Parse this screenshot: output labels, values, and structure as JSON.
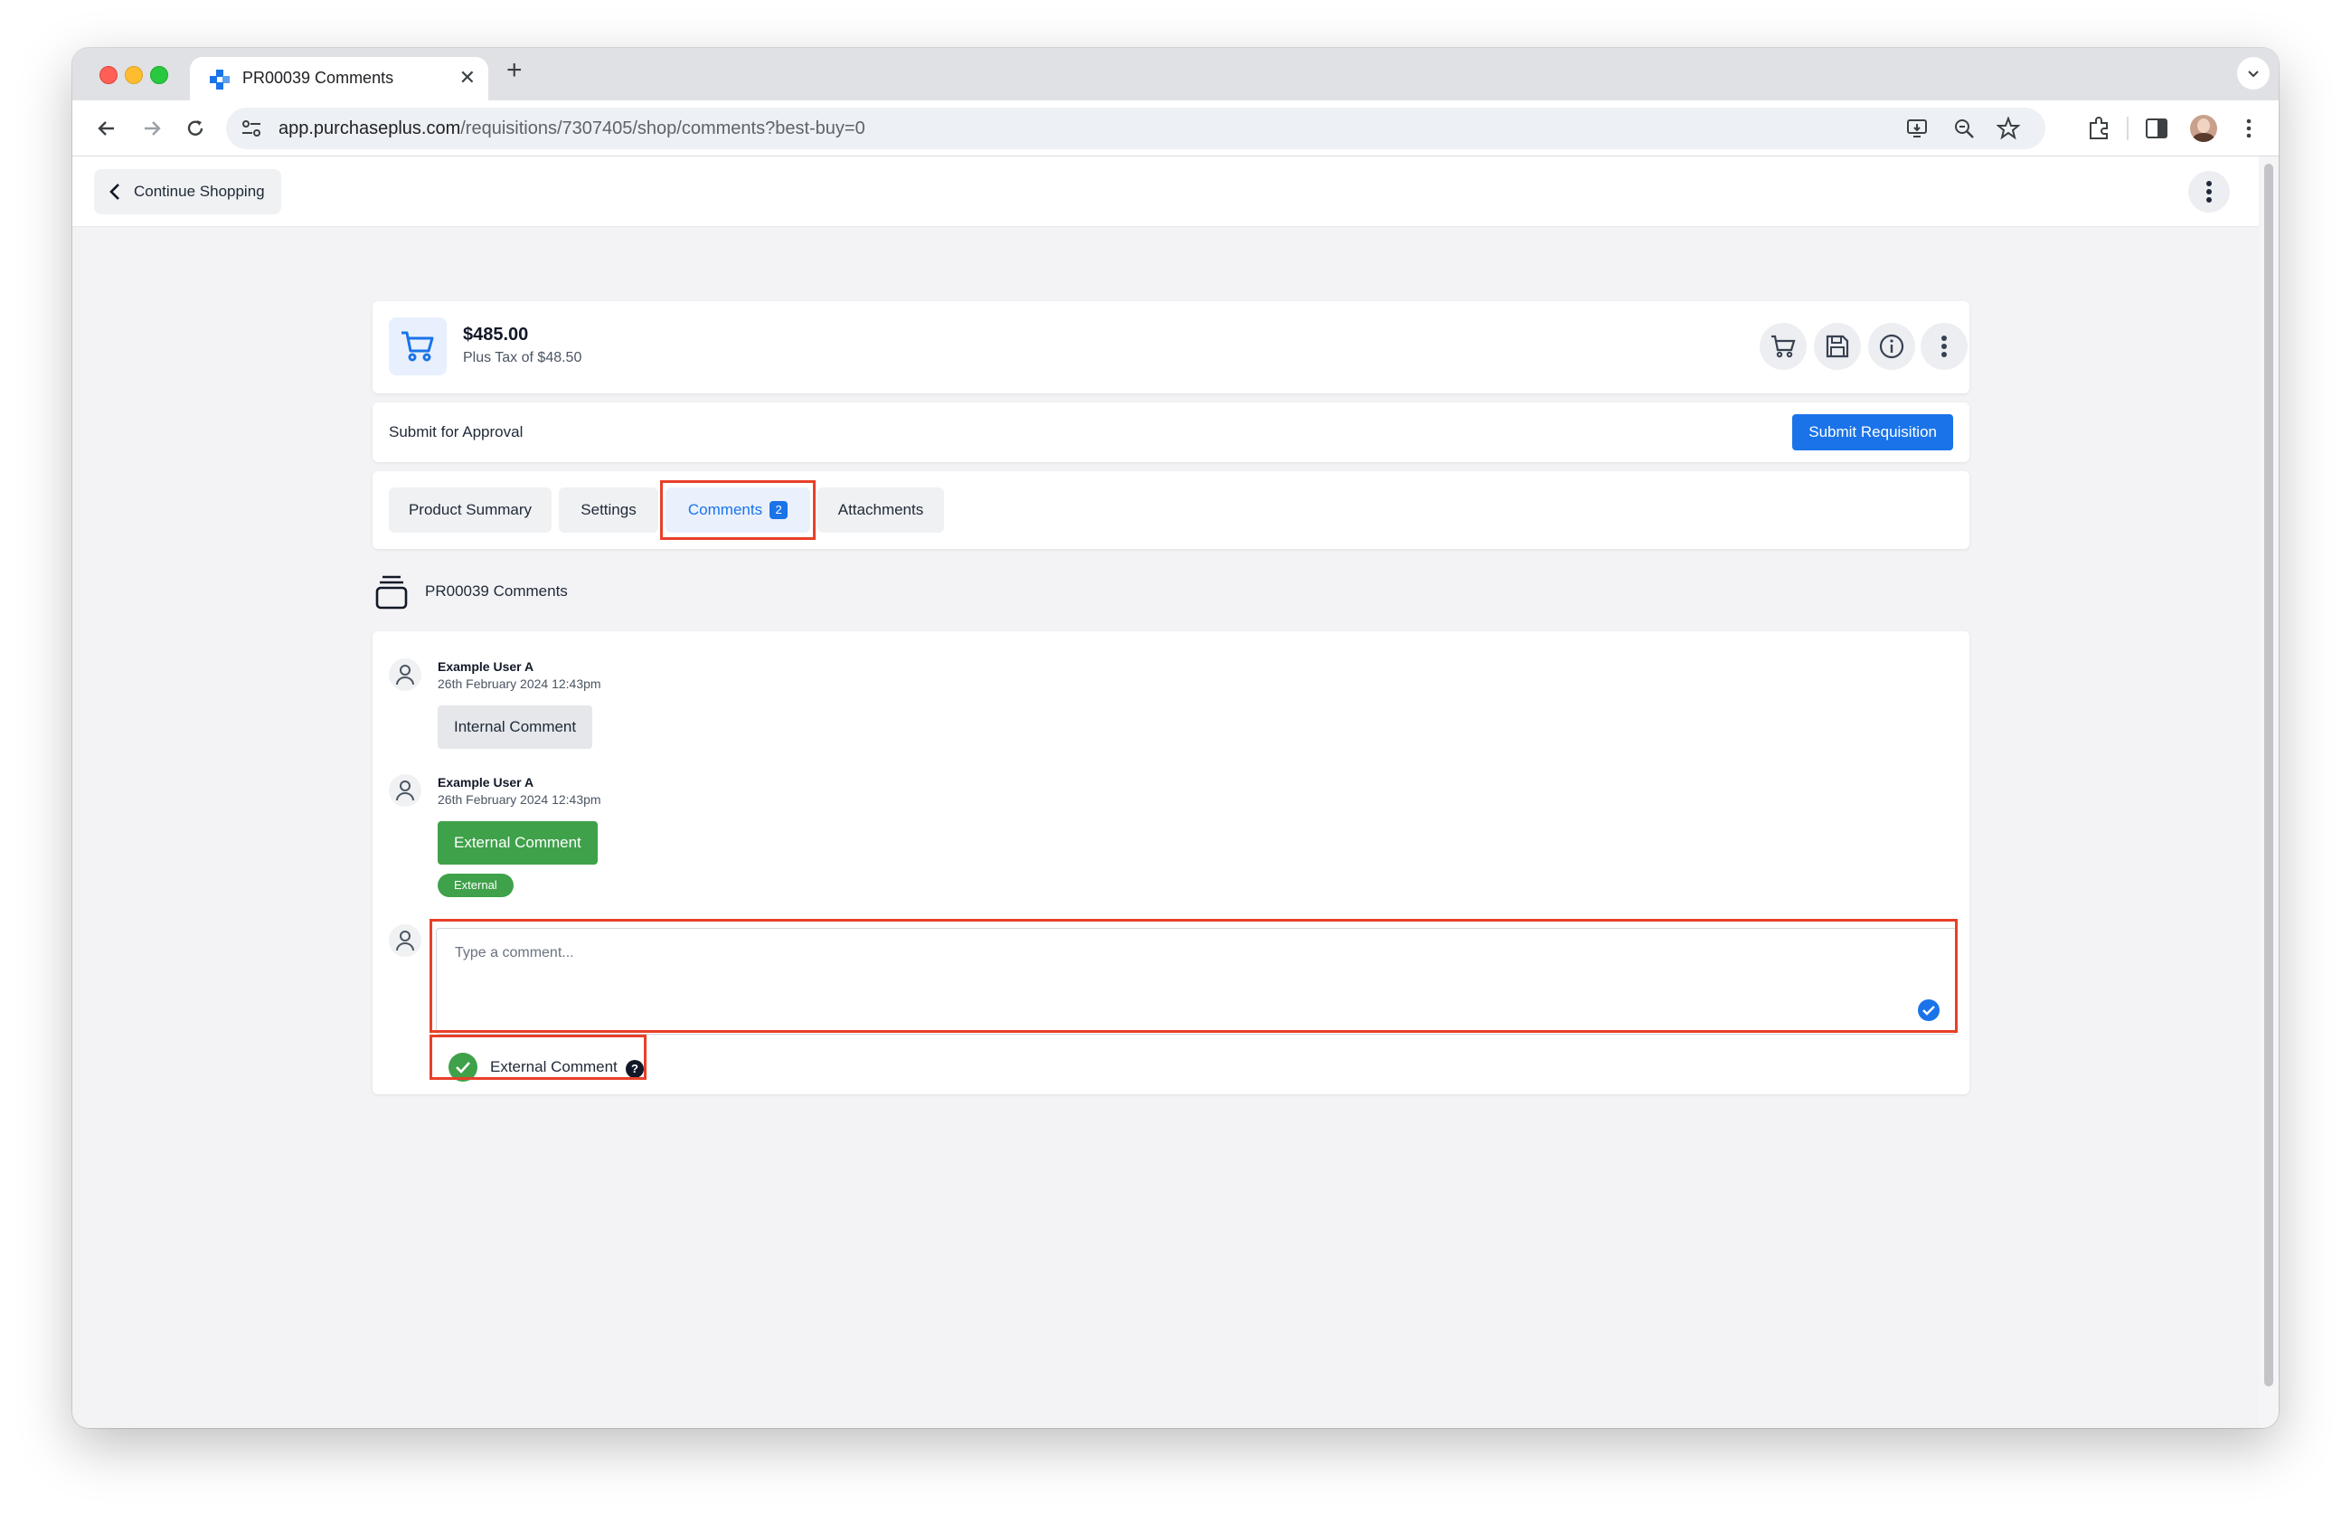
{
  "browser": {
    "tab_title": "PR00039 Comments",
    "url_host": "app.purchaseplus.com",
    "url_path": "/requisitions/7307405/shop/comments?best-buy=0"
  },
  "header": {
    "continue_label": "Continue Shopping"
  },
  "cart": {
    "total": "$485.00",
    "tax": "Plus Tax of $48.50"
  },
  "approval": {
    "label": "Submit for Approval",
    "submit_label": "Submit Requisition"
  },
  "tabs": [
    {
      "label": "Product Summary"
    },
    {
      "label": "Settings"
    },
    {
      "label": "Comments",
      "badge": "2"
    },
    {
      "label": "Attachments"
    }
  ],
  "section": {
    "title": "PR00039 Comments"
  },
  "comments": [
    {
      "author": "Example User A",
      "date": "26th February 2024 12:43pm",
      "text": "Internal Comment",
      "type": "internal"
    },
    {
      "author": "Example User A",
      "date": "26th February 2024 12:43pm",
      "text": "External Comment",
      "type": "external",
      "tag": "External"
    }
  ],
  "composer": {
    "placeholder": "Type a comment...",
    "external_toggle_label": "External Comment",
    "help_glyph": "?"
  },
  "colors": {
    "primary": "#1a73e8",
    "external_green": "#3fa14a",
    "highlight_red": "#e8402a"
  }
}
